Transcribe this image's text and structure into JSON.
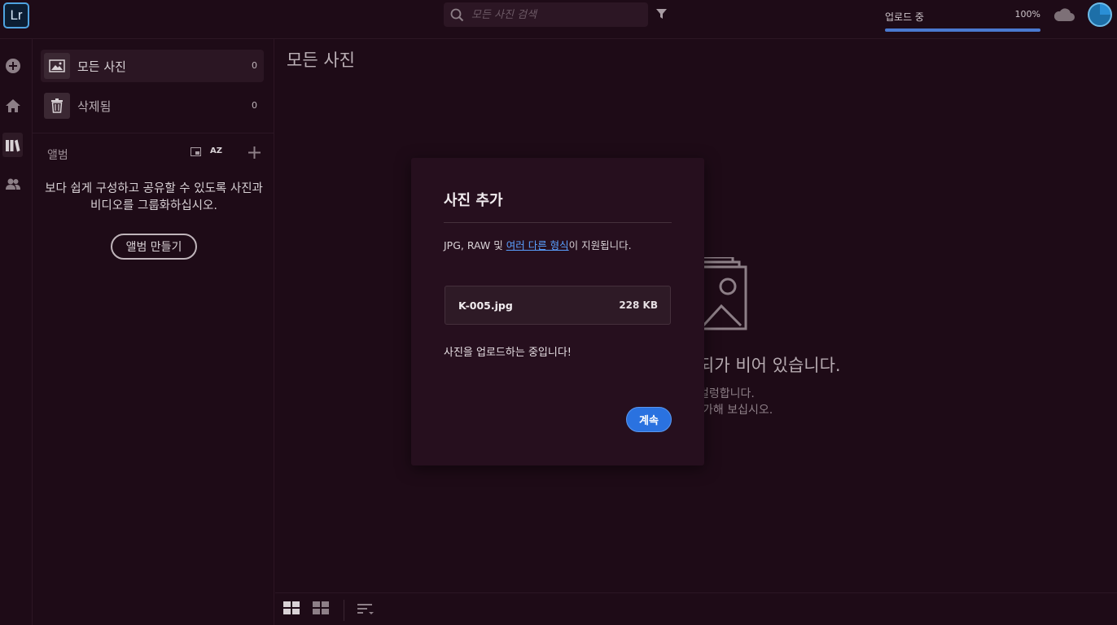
{
  "app": {
    "logo_text": "Lr"
  },
  "search": {
    "placeholder": "모든 사진 검색",
    "value": ""
  },
  "upload": {
    "label": "업로드 중",
    "percent_text": "100%",
    "progress": 1.0
  },
  "rail": {
    "icons": [
      "add-icon",
      "home-icon",
      "library-icon",
      "people-icon"
    ],
    "active": "library-icon"
  },
  "library": {
    "items": [
      {
        "label": "모든 사진",
        "count": "0",
        "icon": "image-icon"
      },
      {
        "label": "삭제됨",
        "count": "0",
        "icon": "trash-icon"
      }
    ]
  },
  "albums": {
    "heading": "앨범",
    "sort_label": "AZ",
    "description": "보다 쉽게 구성하고 공유할 수 있도록 사진과 비디오를 그룹화하십시오.",
    "create_label": "앨범 만들기"
  },
  "main": {
    "title": "모든 사진",
    "empty_title": "되가 비어 있습니다.",
    "empty_line1": "컬렁합니다.",
    "empty_line2": "-가해 보십시오."
  },
  "dialog": {
    "title": "사진 추가",
    "support_prefix": "JPG, RAW 및 ",
    "support_link": "여러 다른 형식",
    "support_suffix": "이 지원됩니다.",
    "file": {
      "name": "K-005.jpg",
      "size": "228 KB"
    },
    "status": "사진을 업로드하는 중입니다!",
    "continue_label": "계속"
  },
  "colors": {
    "background": "#1e0b17",
    "accent": "#2a72e0",
    "link": "#5aa0ff"
  }
}
